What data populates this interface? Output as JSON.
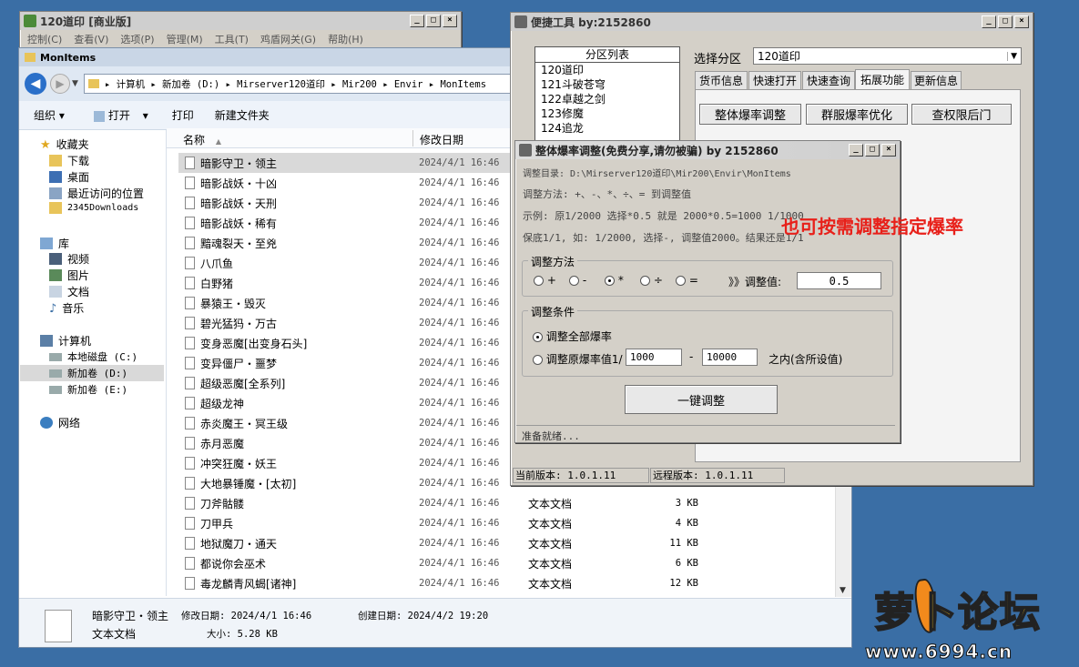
{
  "app_window": {
    "title": "120道印 [商业版]",
    "menu": [
      "控制(C)",
      "查看(V)",
      "选项(P)",
      "管理(M)",
      "工具(T)",
      "鸡盾网关(G)",
      "帮助(H)"
    ]
  },
  "explorer": {
    "title": "MonItems",
    "breadcrumb": [
      "计算机",
      "新加卷 (D:)",
      "Mirserver120道印",
      "Mir200",
      "Envir",
      "MonItems"
    ],
    "toolbar": {
      "organize": "组织",
      "open": "打开",
      "print": "打印",
      "new_folder": "新建文件夹"
    },
    "columns": {
      "name": "名称",
      "date": "修改日期"
    },
    "nav": {
      "favorites": "收藏夹",
      "fav_items": [
        "下载",
        "桌面",
        "最近访问的位置",
        "2345Downloads"
      ],
      "libraries": "库",
      "lib_items": [
        "视频",
        "图片",
        "文档",
        "音乐"
      ],
      "computer": "计算机",
      "drives": [
        "本地磁盘 (C:)",
        "新加卷 (D:)",
        "新加卷 (E:)"
      ],
      "network": "网络"
    },
    "files": [
      {
        "name": "暗影守卫・领主",
        "date": "2024/4/1 16:46",
        "type": "",
        "size": ""
      },
      {
        "name": "暗影战妖・十凶",
        "date": "2024/4/1 16:46",
        "type": "",
        "size": ""
      },
      {
        "name": "暗影战妖・天刑",
        "date": "2024/4/1 16:46",
        "type": "",
        "size": ""
      },
      {
        "name": "暗影战妖・稀有",
        "date": "2024/4/1 16:46",
        "type": "",
        "size": ""
      },
      {
        "name": "黯魂裂天・至兇",
        "date": "2024/4/1 16:46",
        "type": "",
        "size": ""
      },
      {
        "name": "八爪鱼",
        "date": "2024/4/1 16:46",
        "type": "",
        "size": ""
      },
      {
        "name": "白野猪",
        "date": "2024/4/1 16:46",
        "type": "",
        "size": ""
      },
      {
        "name": "暴猿王・毁灭",
        "date": "2024/4/1 16:46",
        "type": "",
        "size": ""
      },
      {
        "name": "碧光猛犸・万古",
        "date": "2024/4/1 16:46",
        "type": "",
        "size": ""
      },
      {
        "name": "变身恶魔[出变身石头]",
        "date": "2024/4/1 16:46",
        "type": "",
        "size": ""
      },
      {
        "name": "变异僵尸・噩梦",
        "date": "2024/4/1 16:46",
        "type": "",
        "size": ""
      },
      {
        "name": "超级恶魔[全系列]",
        "date": "2024/4/1 16:46",
        "type": "",
        "size": ""
      },
      {
        "name": "超级龙神",
        "date": "2024/4/1 16:46",
        "type": "",
        "size": ""
      },
      {
        "name": "赤炎魔王・冥王级",
        "date": "2024/4/1 16:46",
        "type": "",
        "size": ""
      },
      {
        "name": "赤月恶魔",
        "date": "2024/4/1 16:46",
        "type": "",
        "size": ""
      },
      {
        "name": "冲突狂魔・妖王",
        "date": "2024/4/1 16:46",
        "type": "",
        "size": ""
      },
      {
        "name": "大地暴锤魔・[太初]",
        "date": "2024/4/1 16:46",
        "type": "",
        "size": ""
      },
      {
        "name": "刀斧骷髅",
        "date": "2024/4/1 16:46",
        "type": "文本文档",
        "size": "3 KB"
      },
      {
        "name": "刀甲兵",
        "date": "2024/4/1 16:46",
        "type": "文本文档",
        "size": "4 KB"
      },
      {
        "name": "地狱魔刀・通天",
        "date": "2024/4/1 16:46",
        "type": "文本文档",
        "size": "11 KB"
      },
      {
        "name": "都说你会巫术",
        "date": "2024/4/1 16:46",
        "type": "文本文档",
        "size": "6 KB"
      },
      {
        "name": "毒龙麟青风蝎[诸神]",
        "date": "2024/4/1 16:46",
        "type": "文本文档",
        "size": "12 KB"
      }
    ],
    "details": {
      "name": "暗影守卫・领主",
      "modified_label": "修改日期: 2024/4/1 16:46",
      "created_label": "创建日期: 2024/4/2 19:20",
      "type": "文本文档",
      "size_label": "大小: 5.28 KB"
    }
  },
  "quick_tools": {
    "title": "便捷工具   by:2152860",
    "partition_list_header": "分区列表",
    "partitions": [
      "120道印",
      "121斗破苍穹",
      "122卓越之剑",
      "123修魔",
      "124追龙"
    ],
    "select_label": "选择分区",
    "select_value": "120道印",
    "tabs": [
      "货币信息",
      "快速打开",
      "快速查询",
      "拓展功能",
      "更新信息"
    ],
    "selected_tab": 3,
    "buttons": [
      "整体爆率调整",
      "群服爆率优化",
      "查权限后门"
    ],
    "current_version": "当前版本: 1.0.1.11",
    "remote_version": "远程版本: 1.0.1.11"
  },
  "drop_dialog": {
    "title": "整体爆率调整(免费分享,请勿被骗)   by 2152860",
    "dir_line": "调整目录: D:\\Mirserver120道印\\Mir200\\Envir\\MonItems",
    "method_line": "调整方法: +、-、*、÷、=  到调整值",
    "example_line": "示例: 原1/2000 选择*0.5 就是 2000*0.5=1000  1/1000",
    "keep_line": "保底1/1, 如: 1/2000, 选择-, 调整值2000。结果还是1/1",
    "method_group": "调整方法",
    "ops": [
      "+",
      "-",
      "*",
      "÷",
      "="
    ],
    "selected_op": 2,
    "value_label": "》》调整值:",
    "value": "0.5",
    "cond_group": "调整条件",
    "cond_all": "调整全部爆率",
    "cond_range": "调整原爆率值1/",
    "range_from": "1000",
    "range_dash": "-",
    "range_to": "10000",
    "range_suffix": "之内(含所设值)",
    "run_button": "一键调整",
    "status": "准备就绪..."
  },
  "annotation": "也可按需调整指定爆率",
  "watermark": {
    "logo_text": "萝卜论坛",
    "url": "www.6994.cn"
  },
  "colors": {
    "desktop": "#3a6ea5",
    "annotation_red": "#e8201a",
    "select_highlight": "#cce8ff"
  }
}
